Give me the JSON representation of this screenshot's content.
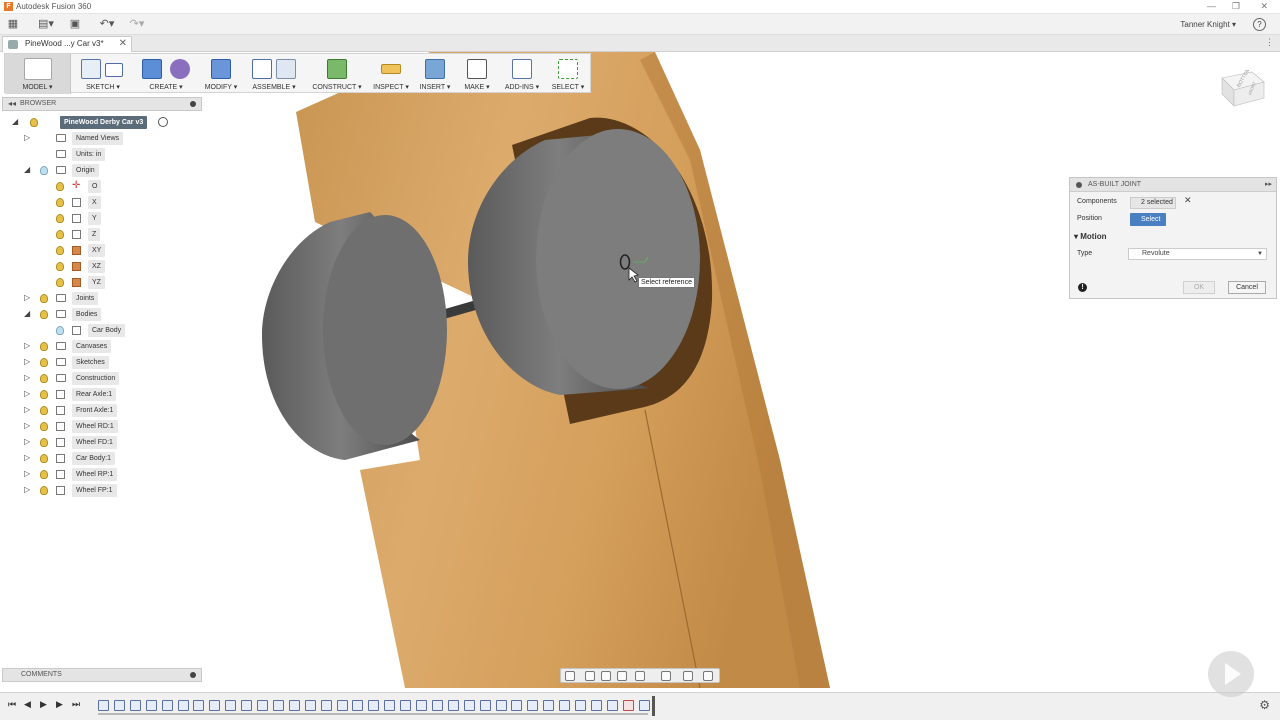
{
  "app": {
    "title": "Autodesk Fusion 360",
    "user": "Tanner Knight",
    "help": "?"
  },
  "quick_access": {
    "grid_icon": "grid-icon",
    "file_icon": "file-icon",
    "save_icon": "save-icon",
    "undo_icon": "undo-icon",
    "redo_icon": "redo-icon"
  },
  "document_tab": {
    "label": "PineWood ...y Car v3*",
    "close": "✕"
  },
  "toolbar": [
    {
      "name": "model",
      "label": "MODEL ▾"
    },
    {
      "name": "sketch",
      "label": "SKETCH ▾"
    },
    {
      "name": "create",
      "label": "CREATE ▾"
    },
    {
      "name": "modify",
      "label": "MODIFY ▾"
    },
    {
      "name": "assemble",
      "label": "ASSEMBLE ▾"
    },
    {
      "name": "construct",
      "label": "CONSTRUCT ▾"
    },
    {
      "name": "inspect",
      "label": "INSPECT ▾"
    },
    {
      "name": "insert",
      "label": "INSERT ▾"
    },
    {
      "name": "make",
      "label": "MAKE ▾"
    },
    {
      "name": "addins",
      "label": "ADD-INS ▾"
    },
    {
      "name": "select",
      "label": "SELECT ▾"
    }
  ],
  "browser": {
    "title": "BROWSER",
    "root": "PineWood Derby Car v3",
    "items": [
      {
        "label": "Named Views",
        "level": 1,
        "exp": true,
        "bulb": false,
        "type": "folder"
      },
      {
        "label": "Units: in",
        "level": 1,
        "exp": false,
        "bulb": false,
        "type": "doc"
      },
      {
        "label": "Origin",
        "level": 1,
        "exp": true,
        "open": true,
        "bulb": "off",
        "type": "folder"
      },
      {
        "label": "O",
        "level": 2,
        "exp": false,
        "bulb": "on",
        "type": "point"
      },
      {
        "label": "X",
        "level": 2,
        "exp": false,
        "bulb": "on",
        "type": "axis"
      },
      {
        "label": "Y",
        "level": 2,
        "exp": false,
        "bulb": "on",
        "type": "axis"
      },
      {
        "label": "Z",
        "level": 2,
        "exp": false,
        "bulb": "on",
        "type": "axis"
      },
      {
        "label": "XY",
        "level": 2,
        "exp": false,
        "bulb": "on",
        "type": "plane"
      },
      {
        "label": "XZ",
        "level": 2,
        "exp": false,
        "bulb": "on",
        "type": "plane"
      },
      {
        "label": "YZ",
        "level": 2,
        "exp": false,
        "bulb": "on",
        "type": "plane"
      },
      {
        "label": "Joints",
        "level": 1,
        "exp": true,
        "bulb": "on",
        "type": "folder"
      },
      {
        "label": "Bodies",
        "level": 1,
        "exp": true,
        "open": true,
        "bulb": "on",
        "type": "folder"
      },
      {
        "label": "Car Body",
        "level": 2,
        "exp": false,
        "bulb": "off",
        "type": "body"
      },
      {
        "label": "Canvases",
        "level": 1,
        "exp": true,
        "bulb": "on",
        "type": "folder"
      },
      {
        "label": "Sketches",
        "level": 1,
        "exp": true,
        "bulb": "on",
        "type": "folder"
      },
      {
        "label": "Construction",
        "level": 1,
        "exp": true,
        "bulb": "on",
        "type": "folder"
      },
      {
        "label": "Rear Axle:1",
        "level": 1,
        "exp": true,
        "bulb": "on",
        "type": "comp"
      },
      {
        "label": "Front Axle:1",
        "level": 1,
        "exp": true,
        "bulb": "on",
        "type": "comp"
      },
      {
        "label": "Wheel RD:1",
        "level": 1,
        "exp": true,
        "bulb": "on",
        "type": "comp"
      },
      {
        "label": "Wheel FD:1",
        "level": 1,
        "exp": true,
        "bulb": "on",
        "type": "comp"
      },
      {
        "label": "Car Body:1",
        "level": 1,
        "exp": true,
        "bulb": "on",
        "type": "comp"
      },
      {
        "label": "Wheel RP:1",
        "level": 1,
        "exp": true,
        "bulb": "on",
        "type": "comp"
      },
      {
        "label": "Wheel FP:1",
        "level": 1,
        "exp": true,
        "bulb": "on",
        "type": "comp"
      }
    ]
  },
  "comments": {
    "title": "COMMENTS"
  },
  "viewcube": {
    "label": "BOTTOM",
    "label2": "FRONT"
  },
  "joint_panel": {
    "title": "AS-BUILT JOINT",
    "components_label": "Components",
    "components_value": "2 selected",
    "clear": "✕",
    "position_label": "Position",
    "position_button": "Select",
    "motion_label": "Motion",
    "type_label": "Type",
    "type_value": "Revolute",
    "ok": "OK",
    "cancel": "Cancel"
  },
  "tooltip": "Select reference",
  "colors": {
    "wood": "#d9a463",
    "wood_dark": "#b87f3e",
    "wheel": "#8a8a8a",
    "accent_blue": "#4a7fc1"
  }
}
